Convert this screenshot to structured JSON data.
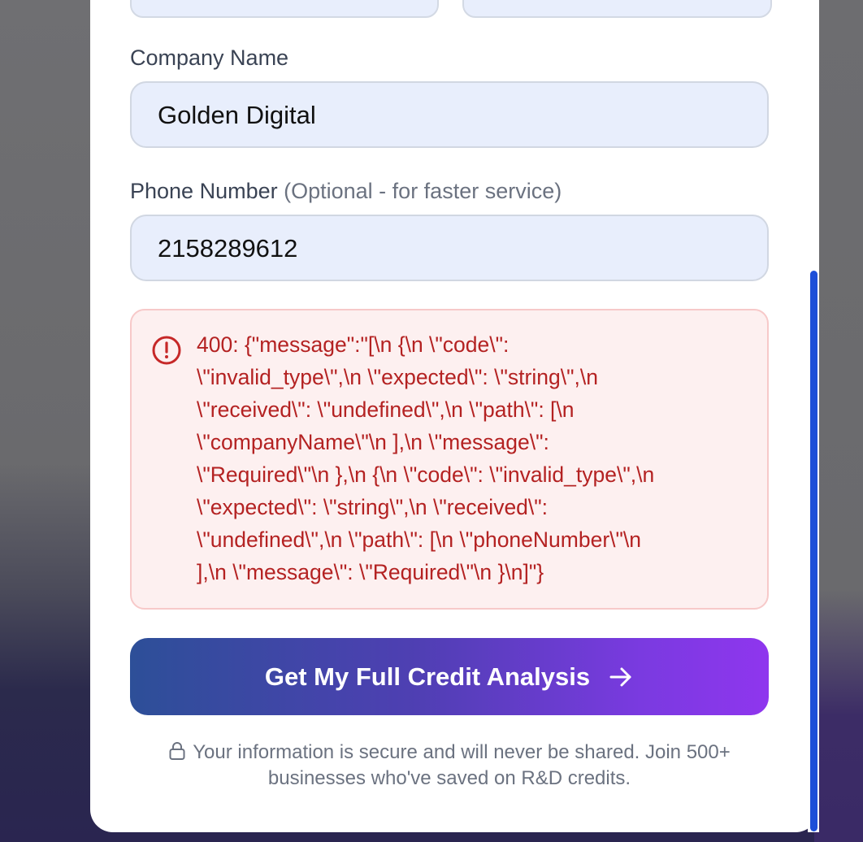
{
  "form": {
    "company_label": "Company Name",
    "company_value": "Golden Digital",
    "phone_label": "Phone Number",
    "phone_hint": "(Optional - for faster service)",
    "phone_value": "2158289612"
  },
  "error": {
    "icon": "alert-circle-icon",
    "lines": [
      "400: {\"message\":\"[\\n {\\n \\\"code\\\":",
      "\\\"invalid_type\\\",\\n \\\"expected\\\": \\\"string\\\",\\n",
      "\\\"received\\\": \\\"undefined\\\",\\n \\\"path\\\": [\\n",
      "\\\"companyName\\\"\\n ],\\n \\\"message\\\":",
      "\\\"Required\\\"\\n },\\n {\\n \\\"code\\\": \\\"invalid_type\\\",\\n",
      "\\\"expected\\\": \\\"string\\\",\\n \\\"received\\\":",
      "\\\"undefined\\\",\\n \\\"path\\\": [\\n \\\"phoneNumber\\\"\\n",
      "],\\n \\\"message\\\": \\\"Required\\\"\\n }\\n]\"}"
    ]
  },
  "cta": {
    "label": "Get My Full Credit Analysis",
    "icon": "arrow-right-icon"
  },
  "footer": {
    "icon": "lock-icon",
    "text": "Your information is secure and will never be shared. Join 500+ businesses who've saved on R&D credits."
  },
  "colors": {
    "accent": "#1d4fd8",
    "error_text": "#b42222",
    "cta_start": "#2d4f98",
    "cta_end": "#8f36ee"
  }
}
